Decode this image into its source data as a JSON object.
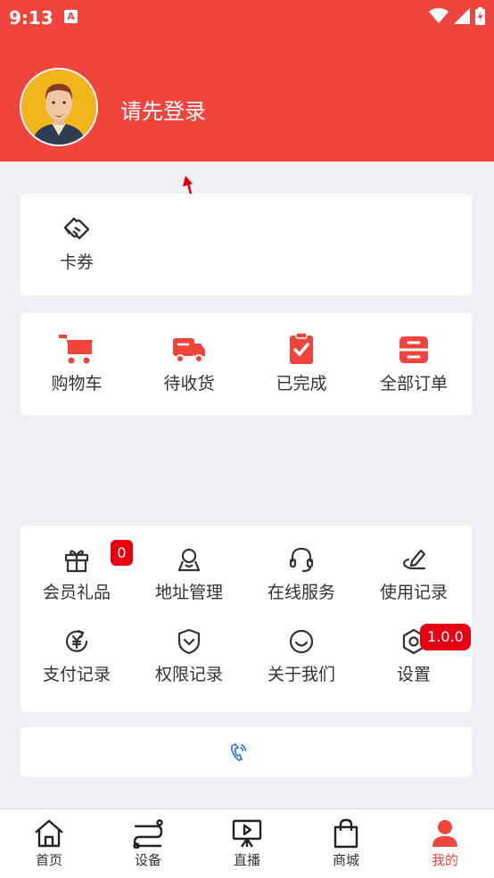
{
  "status_bar": {
    "time": "9:13",
    "notification_icon": "A"
  },
  "profile": {
    "login_prompt": "请先登录"
  },
  "coupon": {
    "label": "卡券"
  },
  "orders": [
    {
      "label": "购物车",
      "icon": "cart-icon"
    },
    {
      "label": "待收货",
      "icon": "truck-icon"
    },
    {
      "label": "已完成",
      "icon": "clipboard-check-icon"
    },
    {
      "label": "全部订单",
      "icon": "order-list-icon"
    }
  ],
  "services": [
    {
      "label": "会员礼品",
      "icon": "gift-icon",
      "badge": "0"
    },
    {
      "label": "地址管理",
      "icon": "address-icon"
    },
    {
      "label": "在线服务",
      "icon": "headset-icon"
    },
    {
      "label": "使用记录",
      "icon": "record-icon"
    },
    {
      "label": "支付记录",
      "icon": "payment-icon"
    },
    {
      "label": "权限记录",
      "icon": "shield-icon"
    },
    {
      "label": "关于我们",
      "icon": "smile-icon"
    },
    {
      "label": "设置",
      "icon": "settings-icon",
      "badge": "1.0.0"
    }
  ],
  "tabs": [
    {
      "label": "首页",
      "icon": "home-icon"
    },
    {
      "label": "设备",
      "icon": "device-icon"
    },
    {
      "label": "直播",
      "icon": "live-icon"
    },
    {
      "label": "商城",
      "icon": "shop-bag-icon"
    },
    {
      "label": "我的",
      "icon": "profile-icon",
      "active": true
    }
  ],
  "colors": {
    "brand_red": "#f0453d",
    "badge_red": "#e60012",
    "accent_blue": "#2b7de9"
  }
}
